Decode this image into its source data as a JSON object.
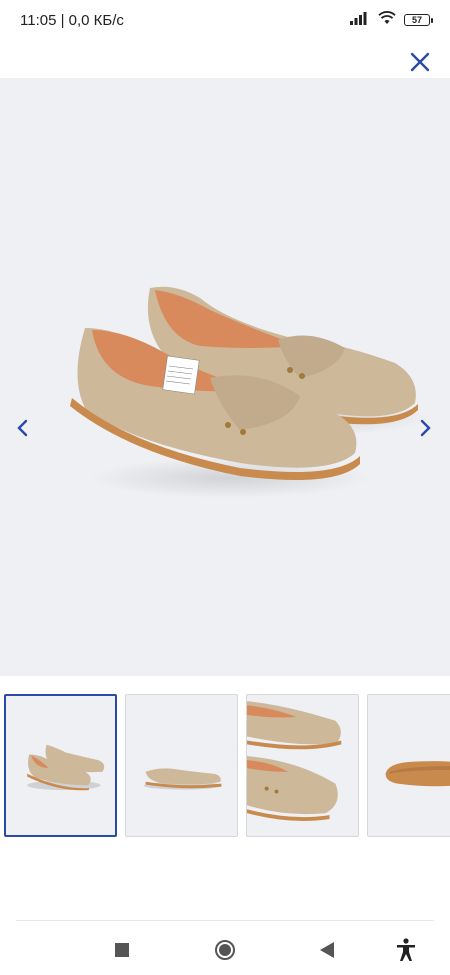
{
  "status_bar": {
    "time_speed": "11:05 | 0,0 КБ/с",
    "battery_level": "57",
    "icons": [
      "signal-icon",
      "wifi-icon",
      "battery-icon"
    ]
  },
  "header": {
    "close_icon": "close-icon",
    "accent_color": "#2b4aa8"
  },
  "gallery": {
    "selected_index": 0,
    "thumbnail_count": 4,
    "prev_icon": "chevron-left-icon",
    "next_icon": "chevron-right-icon",
    "background_color": "#eef0f4"
  },
  "system_nav": {
    "icons": [
      "square-icon",
      "home-circle-icon",
      "back-triangle-icon",
      "accessibility-icon"
    ]
  }
}
